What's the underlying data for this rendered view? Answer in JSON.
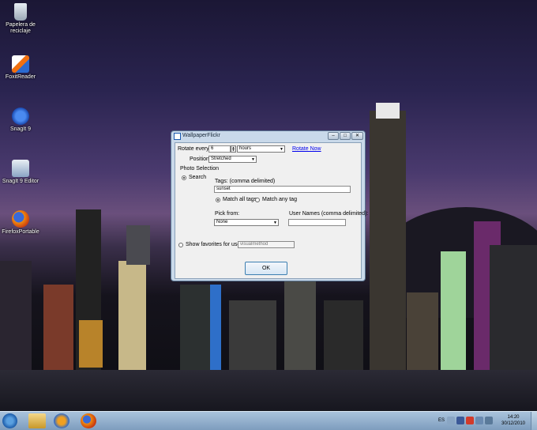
{
  "desktop": {
    "icons": [
      {
        "label": "Papelera de reciclaje"
      },
      {
        "label": "FoxitReader"
      },
      {
        "label": "SnagIt 9"
      },
      {
        "label": "SnagIt 9 Editor"
      },
      {
        "label": "FirefoxPortable"
      }
    ]
  },
  "dialog": {
    "title": "WallpaperFlickr",
    "rotate_label": "Rotate every:",
    "rotate_value": "6",
    "rotate_unit": "hours",
    "rotate_now": "Rotate Now",
    "position_label": "Position:",
    "position_value": "Stretched",
    "photo_selection": "Photo Selection",
    "search_label": "Search",
    "tags_label": "Tags: (comma delimited)",
    "tags_value": "sunset",
    "match_all": "Match all tags",
    "match_any": "Match any tag",
    "pick_from_label": "Pick from:",
    "pick_from_value": "None",
    "user_names_label": "User Names (comma delimited):",
    "user_names_value": "",
    "favorites_label": "Show favorites for user:",
    "favorites_value": "visualmethod",
    "ok": "OK"
  },
  "taskbar": {
    "language": "ES",
    "time": "14:20",
    "date": "30/12/2010"
  }
}
